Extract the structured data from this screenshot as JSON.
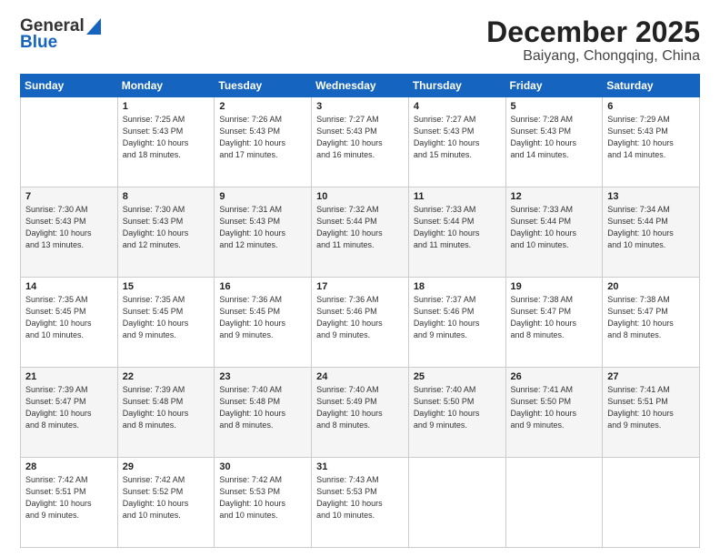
{
  "logo": {
    "general": "General",
    "blue": "Blue"
  },
  "title": "December 2025",
  "subtitle": "Baiyang, Chongqing, China",
  "days": [
    "Sunday",
    "Monday",
    "Tuesday",
    "Wednesday",
    "Thursday",
    "Friday",
    "Saturday"
  ],
  "weeks": [
    [
      {
        "day": "",
        "text": ""
      },
      {
        "day": "1",
        "text": "Sunrise: 7:25 AM\nSunset: 5:43 PM\nDaylight: 10 hours\nand 18 minutes."
      },
      {
        "day": "2",
        "text": "Sunrise: 7:26 AM\nSunset: 5:43 PM\nDaylight: 10 hours\nand 17 minutes."
      },
      {
        "day": "3",
        "text": "Sunrise: 7:27 AM\nSunset: 5:43 PM\nDaylight: 10 hours\nand 16 minutes."
      },
      {
        "day": "4",
        "text": "Sunrise: 7:27 AM\nSunset: 5:43 PM\nDaylight: 10 hours\nand 15 minutes."
      },
      {
        "day": "5",
        "text": "Sunrise: 7:28 AM\nSunset: 5:43 PM\nDaylight: 10 hours\nand 14 minutes."
      },
      {
        "day": "6",
        "text": "Sunrise: 7:29 AM\nSunset: 5:43 PM\nDaylight: 10 hours\nand 14 minutes."
      }
    ],
    [
      {
        "day": "7",
        "text": "Sunrise: 7:30 AM\nSunset: 5:43 PM\nDaylight: 10 hours\nand 13 minutes."
      },
      {
        "day": "8",
        "text": "Sunrise: 7:30 AM\nSunset: 5:43 PM\nDaylight: 10 hours\nand 12 minutes."
      },
      {
        "day": "9",
        "text": "Sunrise: 7:31 AM\nSunset: 5:43 PM\nDaylight: 10 hours\nand 12 minutes."
      },
      {
        "day": "10",
        "text": "Sunrise: 7:32 AM\nSunset: 5:44 PM\nDaylight: 10 hours\nand 11 minutes."
      },
      {
        "day": "11",
        "text": "Sunrise: 7:33 AM\nSunset: 5:44 PM\nDaylight: 10 hours\nand 11 minutes."
      },
      {
        "day": "12",
        "text": "Sunrise: 7:33 AM\nSunset: 5:44 PM\nDaylight: 10 hours\nand 10 minutes."
      },
      {
        "day": "13",
        "text": "Sunrise: 7:34 AM\nSunset: 5:44 PM\nDaylight: 10 hours\nand 10 minutes."
      }
    ],
    [
      {
        "day": "14",
        "text": "Sunrise: 7:35 AM\nSunset: 5:45 PM\nDaylight: 10 hours\nand 10 minutes."
      },
      {
        "day": "15",
        "text": "Sunrise: 7:35 AM\nSunset: 5:45 PM\nDaylight: 10 hours\nand 9 minutes."
      },
      {
        "day": "16",
        "text": "Sunrise: 7:36 AM\nSunset: 5:45 PM\nDaylight: 10 hours\nand 9 minutes."
      },
      {
        "day": "17",
        "text": "Sunrise: 7:36 AM\nSunset: 5:46 PM\nDaylight: 10 hours\nand 9 minutes."
      },
      {
        "day": "18",
        "text": "Sunrise: 7:37 AM\nSunset: 5:46 PM\nDaylight: 10 hours\nand 9 minutes."
      },
      {
        "day": "19",
        "text": "Sunrise: 7:38 AM\nSunset: 5:47 PM\nDaylight: 10 hours\nand 8 minutes."
      },
      {
        "day": "20",
        "text": "Sunrise: 7:38 AM\nSunset: 5:47 PM\nDaylight: 10 hours\nand 8 minutes."
      }
    ],
    [
      {
        "day": "21",
        "text": "Sunrise: 7:39 AM\nSunset: 5:47 PM\nDaylight: 10 hours\nand 8 minutes."
      },
      {
        "day": "22",
        "text": "Sunrise: 7:39 AM\nSunset: 5:48 PM\nDaylight: 10 hours\nand 8 minutes."
      },
      {
        "day": "23",
        "text": "Sunrise: 7:40 AM\nSunset: 5:48 PM\nDaylight: 10 hours\nand 8 minutes."
      },
      {
        "day": "24",
        "text": "Sunrise: 7:40 AM\nSunset: 5:49 PM\nDaylight: 10 hours\nand 8 minutes."
      },
      {
        "day": "25",
        "text": "Sunrise: 7:40 AM\nSunset: 5:50 PM\nDaylight: 10 hours\nand 9 minutes."
      },
      {
        "day": "26",
        "text": "Sunrise: 7:41 AM\nSunset: 5:50 PM\nDaylight: 10 hours\nand 9 minutes."
      },
      {
        "day": "27",
        "text": "Sunrise: 7:41 AM\nSunset: 5:51 PM\nDaylight: 10 hours\nand 9 minutes."
      }
    ],
    [
      {
        "day": "28",
        "text": "Sunrise: 7:42 AM\nSunset: 5:51 PM\nDaylight: 10 hours\nand 9 minutes."
      },
      {
        "day": "29",
        "text": "Sunrise: 7:42 AM\nSunset: 5:52 PM\nDaylight: 10 hours\nand 10 minutes."
      },
      {
        "day": "30",
        "text": "Sunrise: 7:42 AM\nSunset: 5:53 PM\nDaylight: 10 hours\nand 10 minutes."
      },
      {
        "day": "31",
        "text": "Sunrise: 7:43 AM\nSunset: 5:53 PM\nDaylight: 10 hours\nand 10 minutes."
      },
      {
        "day": "",
        "text": ""
      },
      {
        "day": "",
        "text": ""
      },
      {
        "day": "",
        "text": ""
      }
    ]
  ]
}
